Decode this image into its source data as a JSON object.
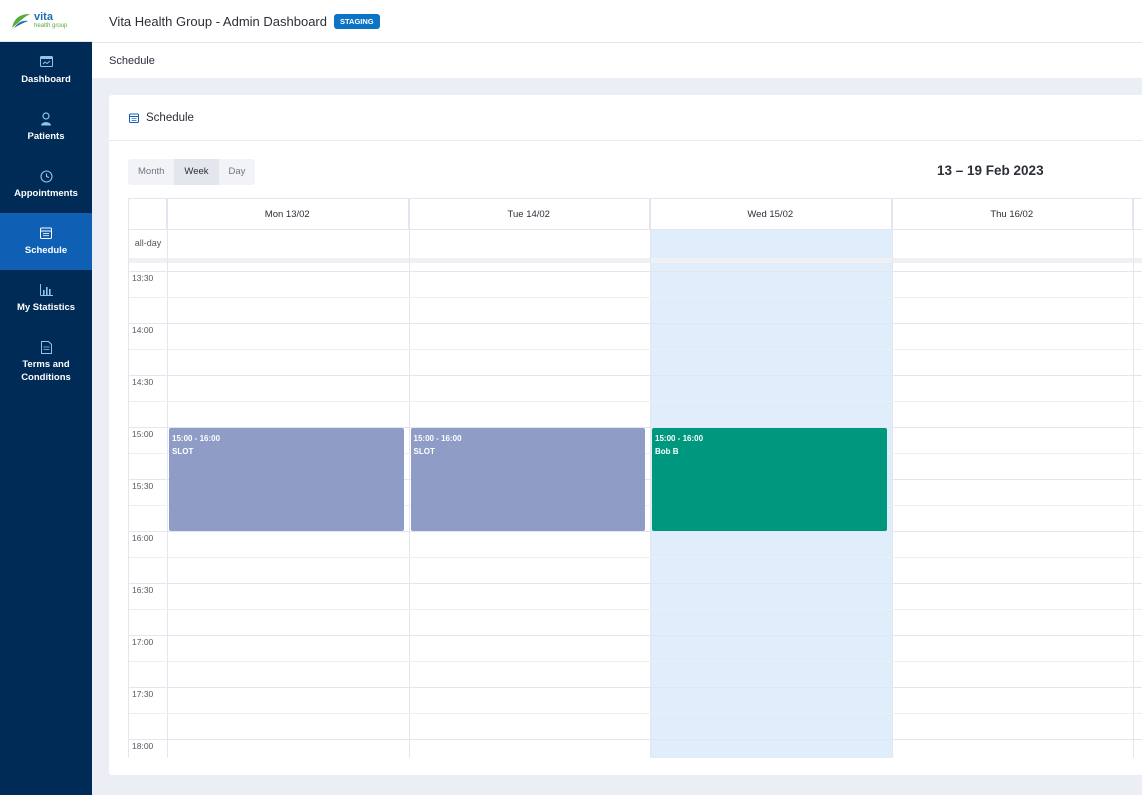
{
  "sidebar": {
    "logo": {
      "main": "vita",
      "sub": "health group"
    },
    "items": [
      {
        "label": "Dashboard",
        "icon": "dashboard-icon"
      },
      {
        "label": "Patients",
        "icon": "patient-icon"
      },
      {
        "label": "Appointments",
        "icon": "clock-icon"
      },
      {
        "label": "Schedule",
        "icon": "calendar-icon",
        "active": true
      },
      {
        "label": "My Statistics",
        "icon": "bar-chart-icon"
      },
      {
        "label": "Terms and Conditions",
        "icon": "document-icon"
      }
    ]
  },
  "header": {
    "title": "Vita Health Group - Admin Dashboard",
    "badge": "STAGING"
  },
  "breadcrumb": "Schedule",
  "card": {
    "title": "Schedule",
    "icon": "calendar-icon"
  },
  "views": [
    "Month",
    "Week",
    "Day"
  ],
  "active_view": "Week",
  "range_title": "13 – 19 Feb 2023",
  "calendar": {
    "all_day_label": "all-day",
    "days": [
      "Mon 13/02",
      "Tue 14/02",
      "Wed 15/02",
      "Thu 16/02"
    ],
    "today_index": 2,
    "start_hour": 13.5,
    "times": [
      "13:30",
      "14:00",
      "14:30",
      "15:00",
      "15:30",
      "16:00",
      "16:30",
      "17:00",
      "17:30",
      "18:00"
    ],
    "events": [
      {
        "day": 0,
        "start": 15,
        "end": 16,
        "time": "15:00 - 16:00",
        "title": "SLOT",
        "kind": "slot"
      },
      {
        "day": 1,
        "start": 15,
        "end": 16,
        "time": "15:00 - 16:00",
        "title": "SLOT",
        "kind": "slot"
      },
      {
        "day": 2,
        "start": 15,
        "end": 16,
        "time": "15:00 - 16:00",
        "title": "Bob B",
        "kind": "booked"
      }
    ]
  },
  "colors": {
    "sidebar_bg": "#002b56",
    "active_nav": "#0f5fb5",
    "slot_event": "#8e9cc6",
    "booked_event": "#00977f",
    "today_bg": "#e0eefc",
    "badge": "#0b74c4"
  }
}
